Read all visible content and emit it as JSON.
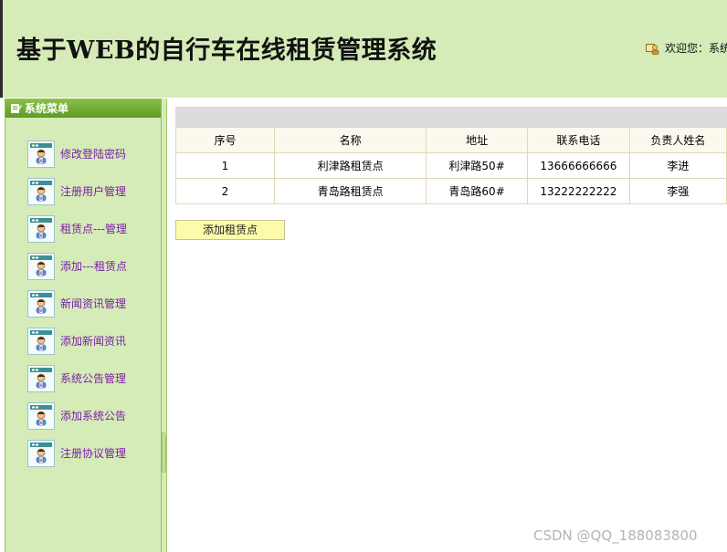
{
  "header": {
    "title": "基于WEB的自行车在线租赁管理系统",
    "welcome": "欢迎您：系统"
  },
  "sidebar": {
    "title": "系统菜单",
    "items": [
      {
        "label": "修改登陆密码"
      },
      {
        "label": "注册用户管理"
      },
      {
        "label": "租赁点---管理"
      },
      {
        "label": "添加---租赁点"
      },
      {
        "label": "新闻资讯管理"
      },
      {
        "label": "添加新闻资讯"
      },
      {
        "label": "系统公告管理"
      },
      {
        "label": "添加系统公告"
      },
      {
        "label": "注册协议管理"
      }
    ]
  },
  "table": {
    "columns": [
      "序号",
      "名称",
      "地址",
      "联系电话",
      "负责人姓名"
    ],
    "rows": [
      [
        "1",
        "利津路租赁点",
        "利津路50#",
        "13666666666",
        "李进"
      ],
      [
        "2",
        "青岛路租赁点",
        "青岛路60#",
        "13222222222",
        "李强"
      ]
    ]
  },
  "actions": {
    "add_label": "添加租赁点"
  },
  "watermark": "CSDN @QQ_188083800",
  "colors": {
    "header_bg": "#d5ebb8",
    "sidebar_head": "#6ba830",
    "menu_text": "#7b1ea8",
    "button_bg": "#fbfbaa"
  }
}
